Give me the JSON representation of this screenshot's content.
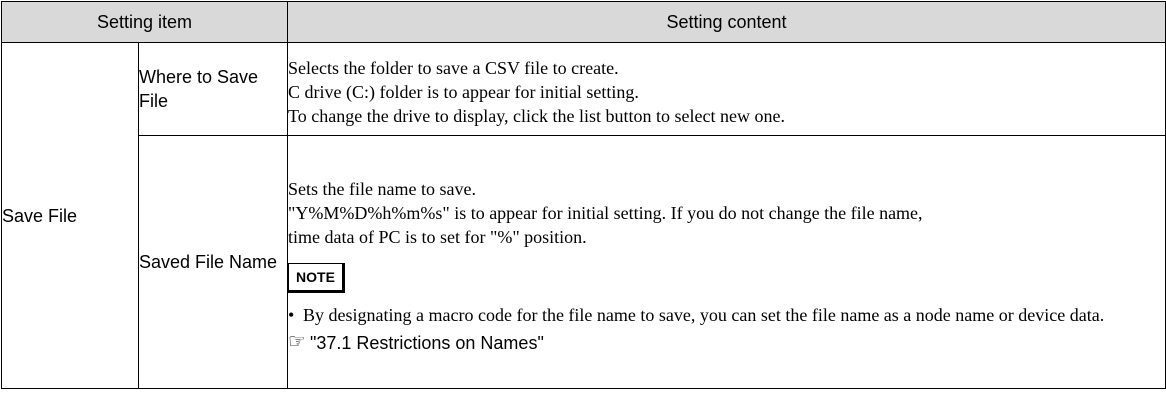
{
  "header": {
    "setting_item": "Setting item",
    "setting_content": "Setting content"
  },
  "group": {
    "label": "Save File"
  },
  "rows": [
    {
      "item": "Where to Save File",
      "lines": [
        "Selects the folder to save a CSV file to create.",
        "C drive (C:) folder is to appear for initial setting.",
        "To change the drive to display, click the list button to select new one."
      ]
    },
    {
      "item": "Saved File Name",
      "lines": [
        "Sets the file name to save.",
        "\"Y%M%D%h%m%s\" is to appear for initial setting. If you do not change the file name,",
        "time data of PC is to set for \"%\" position."
      ],
      "note_label": "NOTE",
      "bullet": "By designating a macro code for the file name to save, you can set the file name as a node name or device data.",
      "reference": "\"37.1 Restrictions on Names\"",
      "reference_icon": "pointing-hand-icon"
    }
  ]
}
